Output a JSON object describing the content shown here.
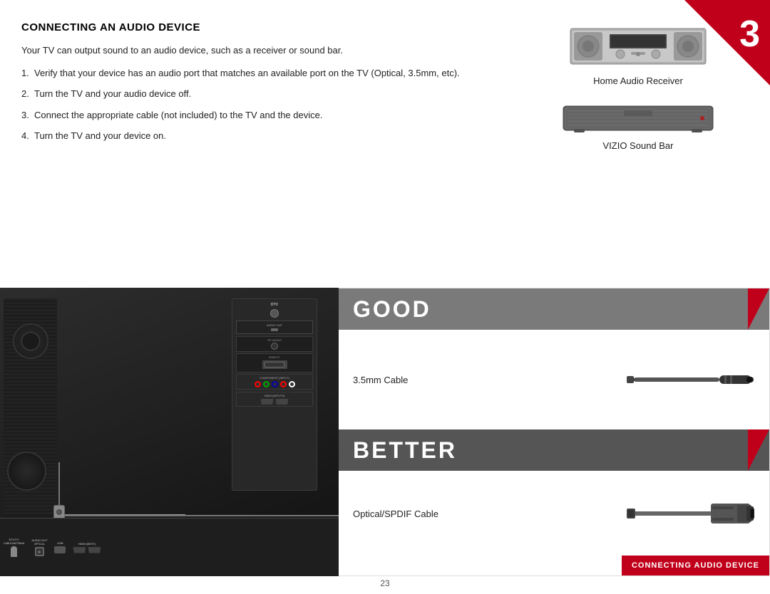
{
  "chapter": {
    "number": "3"
  },
  "section": {
    "title": "CONNECTING AN AUDIO DEVICE",
    "intro": "Your TV can output sound to an audio device, such as a receiver or sound bar.",
    "steps": [
      {
        "num": "1.",
        "text": "Verify that your device has an audio port that matches an available port on the TV (Optical, 3.5mm, etc)."
      },
      {
        "num": "2.",
        "text": "Turn the TV and your audio device off."
      },
      {
        "num": "3.",
        "text": "Connect the appropriate cable (not included) to the TV and the device."
      },
      {
        "num": "4.",
        "text": "Turn the TV and your device on."
      }
    ]
  },
  "devices": [
    {
      "label": "Home Audio Receiver",
      "type": "receiver"
    },
    {
      "label": "VIZIO Sound Bar",
      "type": "soundbar"
    }
  ],
  "quality_levels": [
    {
      "label": "GOOD",
      "cable": "3.5mm Cable"
    },
    {
      "label": "BETTER",
      "cable": "Optical/SPDIF Cable"
    }
  ],
  "footer": {
    "page_number": "23",
    "connecting_badge": "CONNECTING AUDIO DEVICE"
  }
}
